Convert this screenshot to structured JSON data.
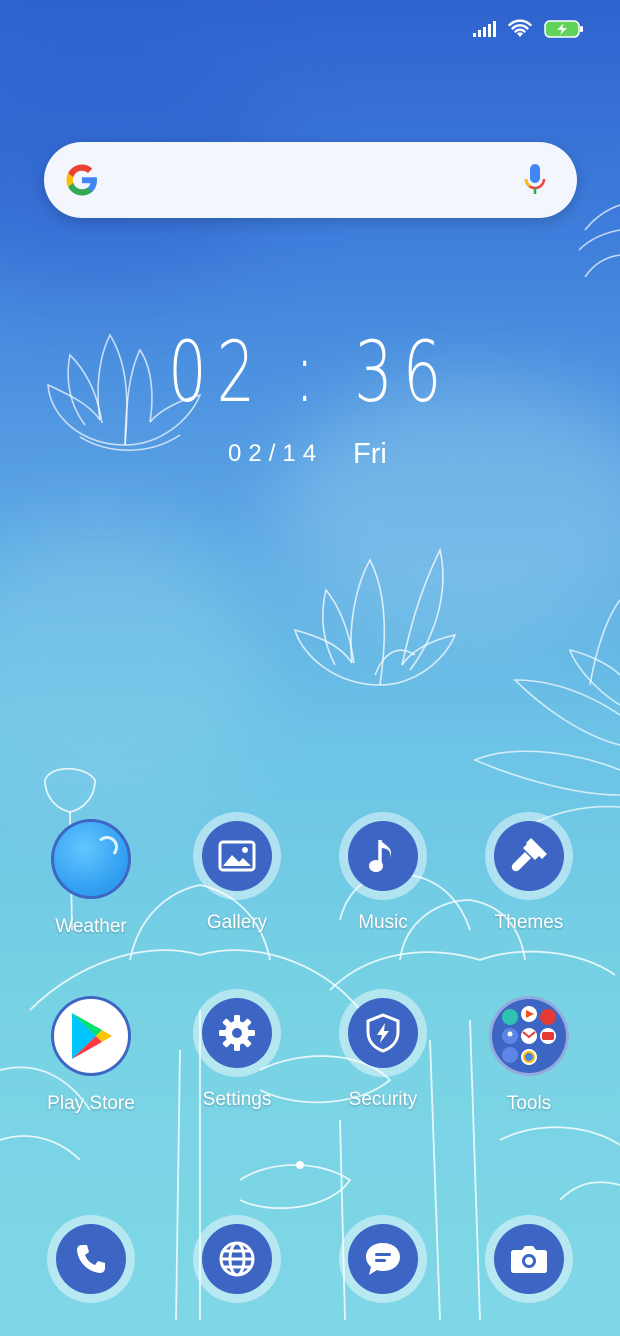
{
  "status_bar": {
    "signal_icon": "cellular-signal-icon",
    "wifi_icon": "wifi-icon",
    "battery_icon": "battery-charging-icon",
    "battery_color": "#5fd35a"
  },
  "search": {
    "logo": "google-g-icon",
    "mic": "voice-search-icon"
  },
  "clock": {
    "time": "02 : 36",
    "date": "02/14",
    "day": "Fri"
  },
  "apps": [
    {
      "label": "Weather",
      "icon": "weather-icon"
    },
    {
      "label": "Gallery",
      "icon": "gallery-icon"
    },
    {
      "label": "Music",
      "icon": "music-note-icon"
    },
    {
      "label": "Themes",
      "icon": "paintbrush-icon"
    },
    {
      "label": "Play Store",
      "icon": "play-store-icon"
    },
    {
      "label": "Settings",
      "icon": "gear-icon"
    },
    {
      "label": "Security",
      "icon": "shield-bolt-icon"
    },
    {
      "label": "Tools",
      "icon": "folder-icon"
    }
  ],
  "dock": [
    {
      "icon": "phone-icon"
    },
    {
      "icon": "browser-globe-icon"
    },
    {
      "icon": "messages-icon"
    },
    {
      "icon": "camera-icon"
    }
  ],
  "colors": {
    "icon_bg": "#3d65c4",
    "accent_blue": "#2f63cf"
  }
}
